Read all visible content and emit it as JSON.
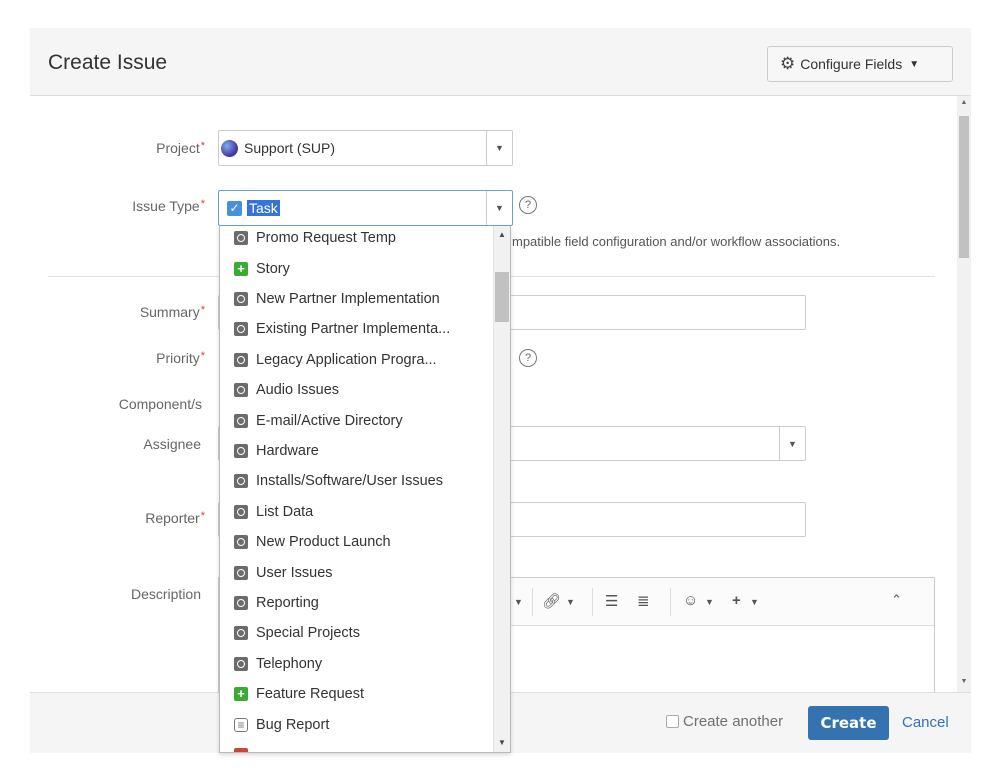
{
  "dialog": {
    "title": "Create Issue",
    "configure_fields_label": "Configure Fields"
  },
  "form": {
    "project": {
      "label": "Project",
      "value": "Support (SUP)"
    },
    "issue_type": {
      "label": "Issue Type",
      "value": "Task"
    },
    "issue_type_note": "mpatible field configuration and/or workflow associations.",
    "summary_label": "Summary",
    "priority_label": "Priority",
    "components_label": "Component/s",
    "assignee_label": "Assignee",
    "reporter_label": "Reporter",
    "description_label": "Description",
    "required_marker": "*"
  },
  "issue_type_dropdown": {
    "items": [
      {
        "label": "Promo Request Temp",
        "icon": "generic"
      },
      {
        "label": "Story",
        "icon": "feature"
      },
      {
        "label": "New Partner Implementation",
        "icon": "generic"
      },
      {
        "label": "Existing Partner Implementa...",
        "icon": "generic"
      },
      {
        "label": "Legacy Application Progra...",
        "icon": "generic"
      },
      {
        "label": "Audio Issues",
        "icon": "generic"
      },
      {
        "label": "E-mail/Active Directory",
        "icon": "generic"
      },
      {
        "label": "Hardware",
        "icon": "generic"
      },
      {
        "label": "Installs/Software/User Issues",
        "icon": "generic"
      },
      {
        "label": "List Data",
        "icon": "generic"
      },
      {
        "label": "New Product Launch",
        "icon": "generic"
      },
      {
        "label": "User Issues",
        "icon": "generic"
      },
      {
        "label": "Reporting",
        "icon": "generic"
      },
      {
        "label": "Special Projects",
        "icon": "generic"
      },
      {
        "label": "Telephony",
        "icon": "generic"
      },
      {
        "label": "Feature Request",
        "icon": "feature"
      },
      {
        "label": "Bug Report",
        "icon": "bug"
      },
      {
        "label": "",
        "icon": "red"
      }
    ]
  },
  "footer": {
    "create_another_label": "Create another",
    "create_label": "Create",
    "cancel_label": "Cancel"
  },
  "colors": {
    "primary_button": "#3572b0",
    "required": "#d04437",
    "selection": "#3572d9"
  }
}
